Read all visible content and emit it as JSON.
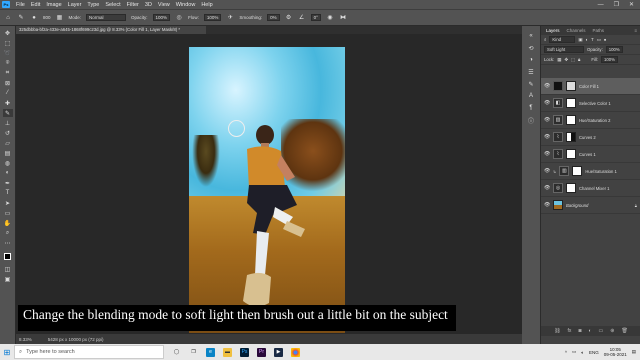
{
  "menubar": {
    "app_icon": "Ps",
    "items": [
      "File",
      "Edit",
      "Image",
      "Layer",
      "Type",
      "Select",
      "Filter",
      "3D",
      "View",
      "Window",
      "Help"
    ],
    "window_controls": [
      "—",
      "❐",
      "✕"
    ]
  },
  "options": {
    "brush_size": "800",
    "mode_label": "Mode:",
    "mode_value": "Normal",
    "opacity_label": "Opacity:",
    "opacity_value": "100%",
    "flow_label": "Flow:",
    "flow_value": "100%",
    "smoothing_label": "Smoothing:",
    "smoothing_value": "0%",
    "angle_value": "0°"
  },
  "document": {
    "tab_title": "325dbbba-bf2a-433e-a645-1868f699c23d.jpg @ 8.33% (Color Fill 1, Layer Mask/8) *",
    "zoom": "8.33%",
    "doc_info": "5428 px x 10000 px (72 ppi)"
  },
  "caption": "Change the blending mode to soft light then brush out a little bit on the subject",
  "panel": {
    "tabs": [
      "Layers",
      "Channels",
      "Paths"
    ],
    "kind_label": "Kind",
    "blend_mode": "Soft Light",
    "opacity_label": "Opacity:",
    "opacity_value": "100%",
    "lock_label": "Lock:",
    "fill_label": "Fill:",
    "fill_value": "100%",
    "layers": [
      {
        "name": "Color Fill 1",
        "type": "fill",
        "selected": true
      },
      {
        "name": "Selective Color 1",
        "type": "adj",
        "selected": false
      },
      {
        "name": "Hue/Saturation 2",
        "type": "adj",
        "selected": false
      },
      {
        "name": "Curves 2",
        "type": "adj",
        "selected": false
      },
      {
        "name": "Curves 1",
        "type": "adj",
        "selected": false
      },
      {
        "name": "Hue/Saturation 1",
        "type": "adj",
        "selected": false
      },
      {
        "name": "Channel Mixer 1",
        "type": "adj",
        "selected": false
      },
      {
        "name": "Background",
        "type": "image",
        "selected": false
      }
    ]
  },
  "taskbar": {
    "search_placeholder": "Type here to search",
    "language": "ENG",
    "time": "10:05",
    "date": "09-05-2021"
  },
  "colors": {
    "ui_panel": "#535353",
    "canvas_bg": "#282828",
    "accent": "#31a8ff"
  }
}
